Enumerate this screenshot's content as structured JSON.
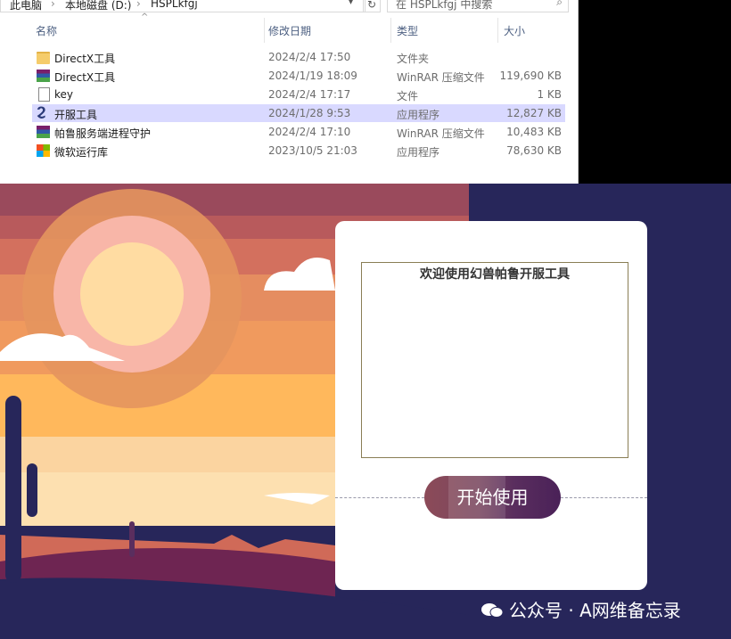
{
  "explorer": {
    "breadcrumb": [
      "此电脑",
      "本地磁盘 (D:)",
      "HSPLkfgj"
    ],
    "breadcrumb_sep": "›",
    "search_placeholder": "在 HSPLkfgj 中搜索",
    "columns": {
      "name": "名称",
      "date": "修改日期",
      "type": "类型",
      "size": "大小"
    },
    "files": [
      {
        "icon": "folder-icon",
        "name": "DirectX工具",
        "date": "2024/2/4 17:50",
        "type": "文件夹",
        "size": ""
      },
      {
        "icon": "winrar-archive-icon",
        "name": "DirectX工具",
        "date": "2024/1/19 18:09",
        "type": "WinRAR 压缩文件",
        "size": "119,690 KB"
      },
      {
        "icon": "file-icon",
        "name": "key",
        "date": "2024/2/4 17:17",
        "type": "文件",
        "size": "1 KB"
      },
      {
        "icon": "tool-app-icon",
        "name": "开服工具",
        "date": "2024/1/28 9:53",
        "type": "应用程序",
        "size": "12,827 KB",
        "selected": true
      },
      {
        "icon": "winrar-archive-icon",
        "name": "帕鲁服务端进程守护",
        "date": "2024/2/4 17:10",
        "type": "WinRAR 压缩文件",
        "size": "10,483 KB"
      },
      {
        "icon": "windows-icon",
        "name": "微软运行库",
        "date": "2023/10/5 21:03",
        "type": "应用程序",
        "size": "78,630 KB"
      }
    ]
  },
  "app": {
    "welcome_text": "欢迎使用幻兽帕鲁开服工具",
    "start_button": "开始使用"
  },
  "watermark": "公众号 · A网维备忘录",
  "colors": {
    "selection": "#d9d9ff",
    "scene_navy": "#27265a",
    "sunset_orange": "#ffb85c"
  }
}
